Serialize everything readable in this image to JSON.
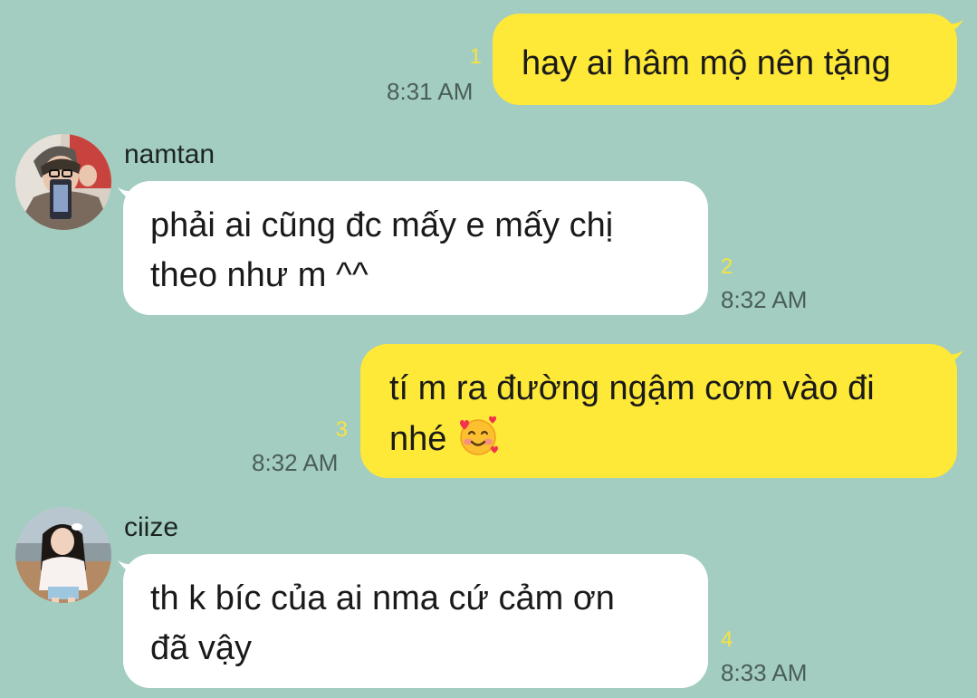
{
  "colors": {
    "background": "#a3cdc0",
    "outgoing_bubble": "#fee838",
    "incoming_bubble": "#ffffff",
    "read_count": "#f6e33f",
    "timestamp": "#4a5e58"
  },
  "messages": [
    {
      "direction": "outgoing",
      "text": "hay ai hâm mộ nên tặng",
      "read_count": "1",
      "time": "8:31 AM"
    },
    {
      "direction": "incoming",
      "sender": "namtan",
      "avatar_icon": "namtan-avatar-photo",
      "line1": "phải ai cũng đc mấy e mấy chị",
      "line2": "theo như m ^^",
      "read_count": "2",
      "time": "8:32 AM"
    },
    {
      "direction": "outgoing",
      "line1": "tí m ra đường ngậm cơm vào đi",
      "line2": "nhé",
      "emoji": "smiling-face-with-hearts",
      "read_count": "3",
      "time": "8:32 AM"
    },
    {
      "direction": "incoming",
      "sender": "ciize",
      "avatar_icon": "ciize-avatar-photo",
      "line1": "th k bíc của ai nma cứ cảm ơn",
      "line2": "đã vậy",
      "read_count": "4",
      "time": "8:33 AM"
    }
  ]
}
